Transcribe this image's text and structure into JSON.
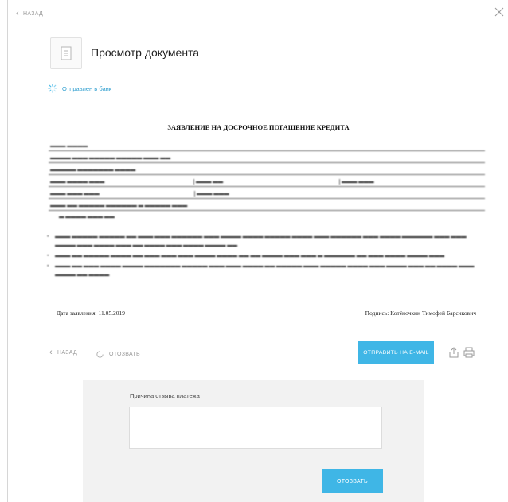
{
  "nav": {
    "back_label": "НАЗАД"
  },
  "header": {
    "title": "Просмотр документа"
  },
  "status": {
    "text": "Отправлен в банк",
    "color": "#2e9ecf"
  },
  "document": {
    "heading": "ЗАЯВЛЕНИЕ НА ДОСРОЧНОЕ ПОГАШЕНИЕ КРЕДИТА",
    "date_label": "Дата заявления: 11.05.2019",
    "signature_label": "Подпись: Котёночкин Тимофей Барсикович"
  },
  "actions": {
    "back_label": "НАЗАД",
    "revoke_label": "ОТОЗВАТЬ",
    "send_email_label": "ОТПРАВИТЬ НА E-MAIL"
  },
  "revoke_panel": {
    "reason_label": "Причина отзыва платежа",
    "reason_value": "",
    "submit_label": "ОТОЗВАТЬ"
  },
  "colors": {
    "accent": "#3fb6e6",
    "panel_bg": "#f2f2f2"
  }
}
